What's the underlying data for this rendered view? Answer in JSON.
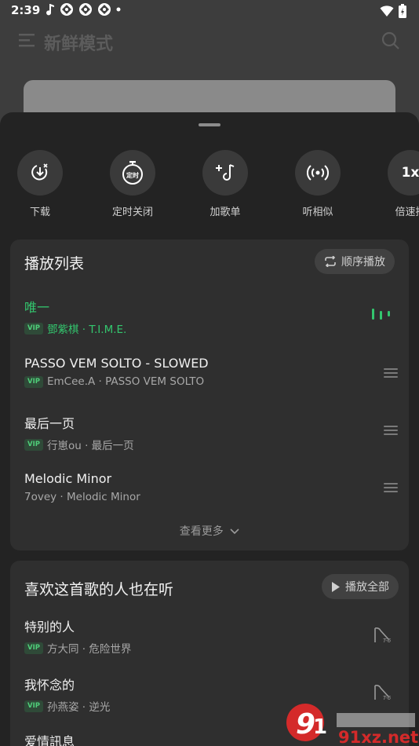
{
  "status_bar": {
    "time": "2:39"
  },
  "background": {
    "title": "新鲜模式"
  },
  "actions": [
    {
      "label": "下载",
      "icon": "download-icon"
    },
    {
      "label": "定时关闭",
      "icon": "timer-icon",
      "icon_text": "定时"
    },
    {
      "label": "加歌单",
      "icon": "add-playlist-icon"
    },
    {
      "label": "听相似",
      "icon": "radio-icon"
    },
    {
      "label": "倍速播",
      "icon": "speed-icon",
      "icon_text": "1x"
    }
  ],
  "playlist": {
    "title": "播放列表",
    "mode_label": "顺序播放",
    "more_label": "查看更多",
    "accent_color": "#33c66e",
    "songs": [
      {
        "name": "唯一",
        "vip": "VIP",
        "meta": "鄧紫棋 · T.I.M.E."
      },
      {
        "name": "PASSO VEM SOLTO - SLOWED",
        "vip": "VIP",
        "meta": "EmCee.A · PASSO VEM SOLTO"
      },
      {
        "name": "最后一页",
        "vip": "VIP",
        "meta": "行崽ou · 最后一页"
      },
      {
        "name": "Melodic Minor",
        "meta": "7ovey · Melodic Minor"
      }
    ]
  },
  "recommend": {
    "title": "喜欢这首歌的人也在听",
    "play_all_label": "播放全部",
    "songs": [
      {
        "name": "特别的人",
        "vip": "VIP",
        "meta": "方大同 · 危险世界"
      },
      {
        "name": "我怀念的",
        "vip": "VIP",
        "meta": "孙燕姿 · 逆光"
      },
      {
        "name": "爱情訊息"
      }
    ]
  },
  "watermark": {
    "text": "91xz.net"
  }
}
